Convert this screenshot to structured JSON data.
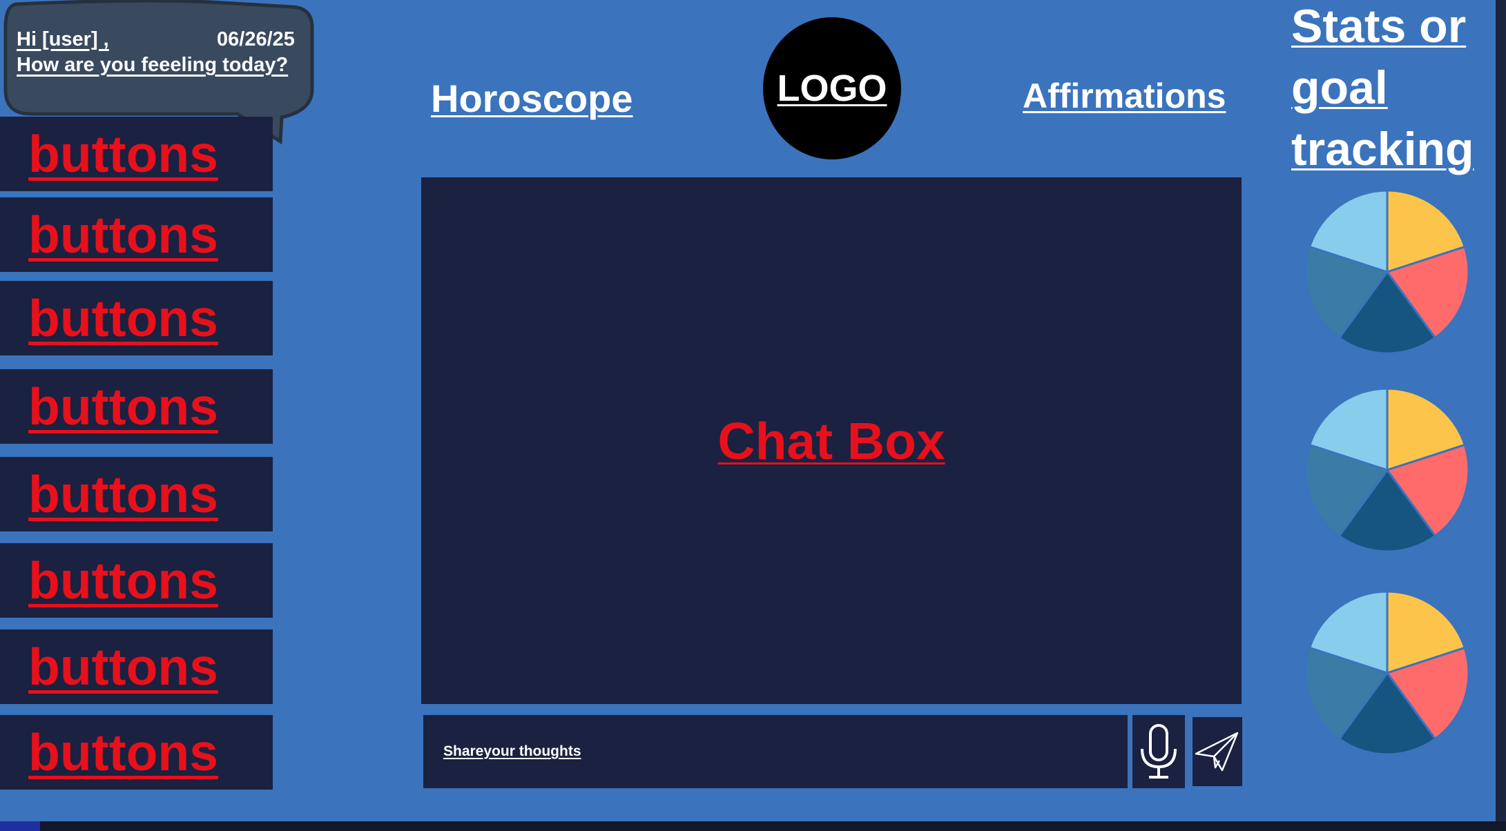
{
  "greeting": {
    "hi_text": "Hi [user] ,",
    "date": "06/26/25",
    "question": "How are you feeeling today?"
  },
  "nav": {
    "horoscope": "Horoscope",
    "logo": "LOGO",
    "affirmations": "Affirmations"
  },
  "sidebar": {
    "buttons": [
      "buttons",
      "buttons",
      "buttons",
      "buttons",
      "buttons",
      "buttons",
      "buttons",
      "buttons"
    ]
  },
  "chat": {
    "title": "Chat Box",
    "input_placeholder": "Shareyour thoughts",
    "mic_icon": "microphone-icon",
    "send_icon": "paper-plane-icon"
  },
  "stats": {
    "title": "Stats or goal tracking",
    "pie_colors": [
      "#fcc44a",
      "#ff6b6b",
      "#16557f",
      "#3a7ca5",
      "#89cdec"
    ],
    "pie_slices": [
      0.2,
      0.2,
      0.2,
      0.2,
      0.2
    ]
  },
  "colors": {
    "background": "#3b73bd",
    "panel": "#1b2140",
    "accent_red": "#e8101b",
    "bubble": "#394a5f"
  }
}
